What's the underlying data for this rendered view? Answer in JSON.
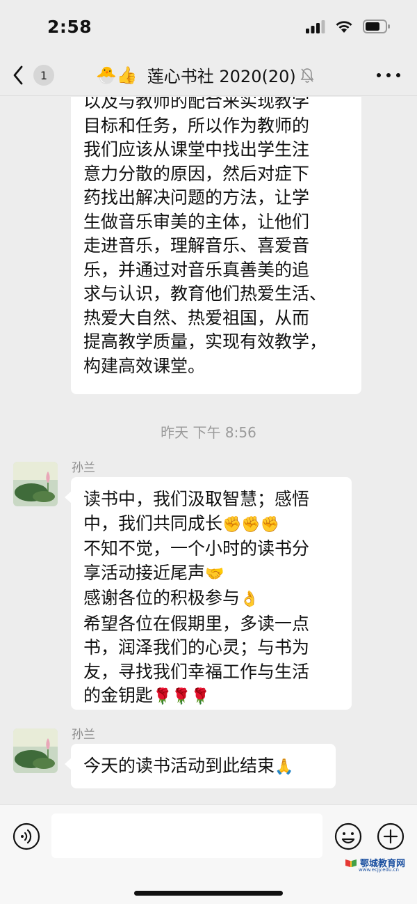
{
  "status_bar": {
    "time": "2:58"
  },
  "nav": {
    "back_badge": "1",
    "title_emojis": "🐣👍",
    "title": "莲心书社 2020(20)"
  },
  "messages": {
    "previous": {
      "lines": [
        "以及与教师的配合来实现教学",
        "目标和任务，所以作为教师的",
        "我们应该从课堂中找出学生注",
        "意力分散的原因，然后对症下",
        "药找出解决问题的方法，让学",
        "生做音乐审美的主体，让他们",
        "走进音乐，理解音乐、喜爱音",
        "乐，并通过对音乐真善美的追",
        "求与认识，教育他们热爱生活、",
        "热爱大自然、热爱祖国，从而",
        "提高教学质量，实现有效教学，",
        "构建高效课堂。"
      ]
    },
    "timestamp": "昨天 下午 8:56",
    "msg1": {
      "sender": "孙兰",
      "line1": "读书中，我们汲取智慧；感悟",
      "line2": "中，我们共同成长",
      "line2_emoji": "✊✊✊",
      "line3": "不知不觉，一个小时的读书分",
      "line4": "享活动接近尾声",
      "line4_emoji": "🤝",
      "line5": "感谢各位的积极参与",
      "line5_emoji": "👌",
      "line6": "希望各位在假期里，多读一点",
      "line7": "书，润泽我们的心灵；与书为",
      "line8": "友，寻找我们幸福工作与生活",
      "line9": "的金钥匙",
      "line9_emoji": "🌹🌹🌹"
    },
    "msg2": {
      "sender": "孙兰",
      "text": "今天的读书活动到此结束",
      "emoji": "🙏"
    }
  },
  "watermark": {
    "name": "鄂城教育网",
    "url": "www.ecjy.edu.cn"
  }
}
